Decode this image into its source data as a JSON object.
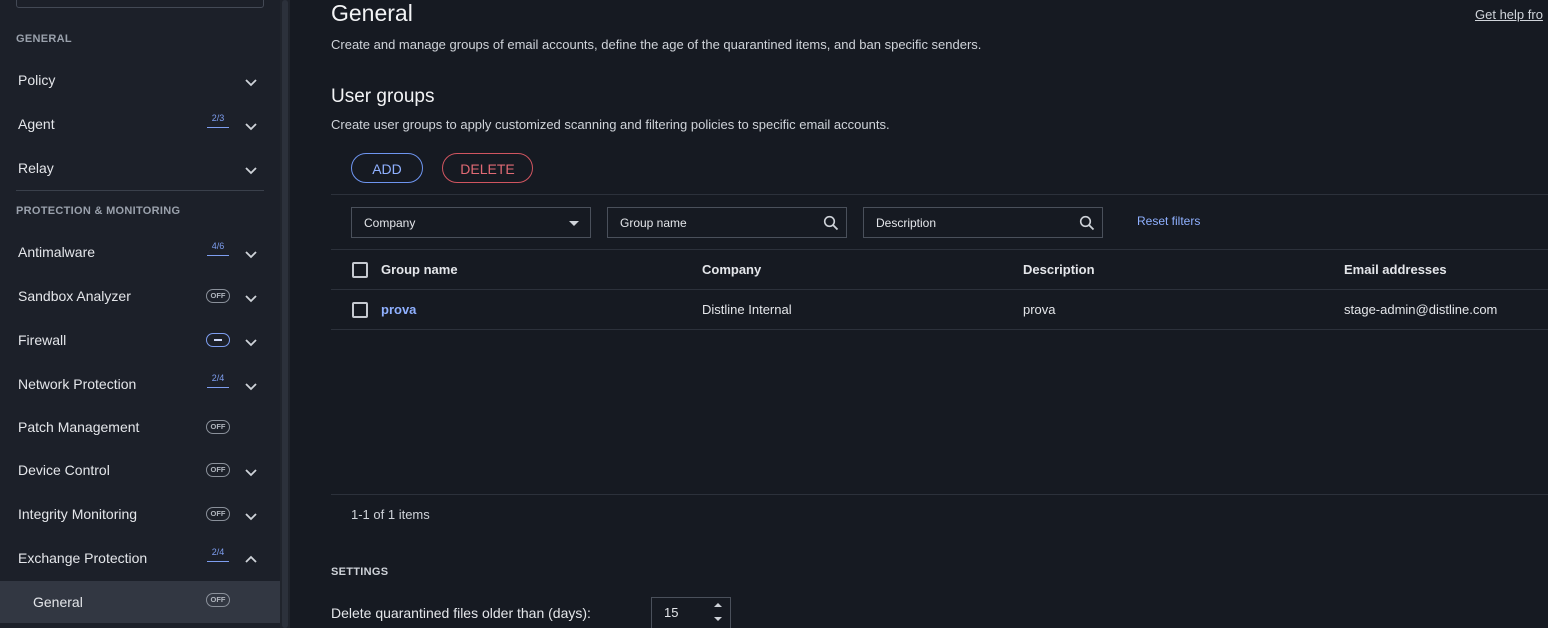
{
  "sidebar": {
    "sections": [
      {
        "title": "GENERAL"
      },
      {
        "title": "PROTECTION & MONITORING"
      }
    ],
    "items": [
      {
        "label": "Policy"
      },
      {
        "label": "Agent",
        "badge": "2/3"
      },
      {
        "label": "Relay"
      },
      {
        "label": "Antimalware",
        "badge": "4/6"
      },
      {
        "label": "Sandbox Analyzer",
        "badge": "OFF"
      },
      {
        "label": "Firewall"
      },
      {
        "label": "Network Protection",
        "badge": "2/4"
      },
      {
        "label": "Patch Management",
        "badge": "OFF"
      },
      {
        "label": "Device Control",
        "badge": "OFF"
      },
      {
        "label": "Integrity Monitoring",
        "badge": "OFF"
      },
      {
        "label": "Exchange Protection",
        "badge": "2/4"
      }
    ],
    "sub_item": {
      "label": "General",
      "badge": "OFF"
    }
  },
  "header": {
    "title": "General",
    "help_link": "Get help fro",
    "description": "Create and manage groups of email accounts, define the age of the quarantined items, and ban specific senders."
  },
  "user_groups": {
    "title": "User groups",
    "description": "Create user groups to apply customized scanning and filtering policies to specific email accounts.",
    "add_label": "ADD",
    "delete_label": "DELETE",
    "filters": {
      "company": "Company",
      "group_name": "Group name",
      "description": "Description",
      "reset": "Reset filters"
    },
    "columns": [
      "Group name",
      "Company",
      "Description",
      "Email addresses"
    ],
    "rows": [
      {
        "group_name": "prova",
        "company": "Distline Internal",
        "description": "prova",
        "email": "stage-admin@distline.com"
      }
    ],
    "pager": "1-1 of 1 items"
  },
  "settings": {
    "title": "SETTINGS",
    "delete_label": "Delete quarantined files older than (days):",
    "delete_days": "15"
  },
  "colors": {
    "accent": "#8fb0ff",
    "danger": "#e06a74",
    "background": "#161a22",
    "sidebar": "#1c2029"
  }
}
